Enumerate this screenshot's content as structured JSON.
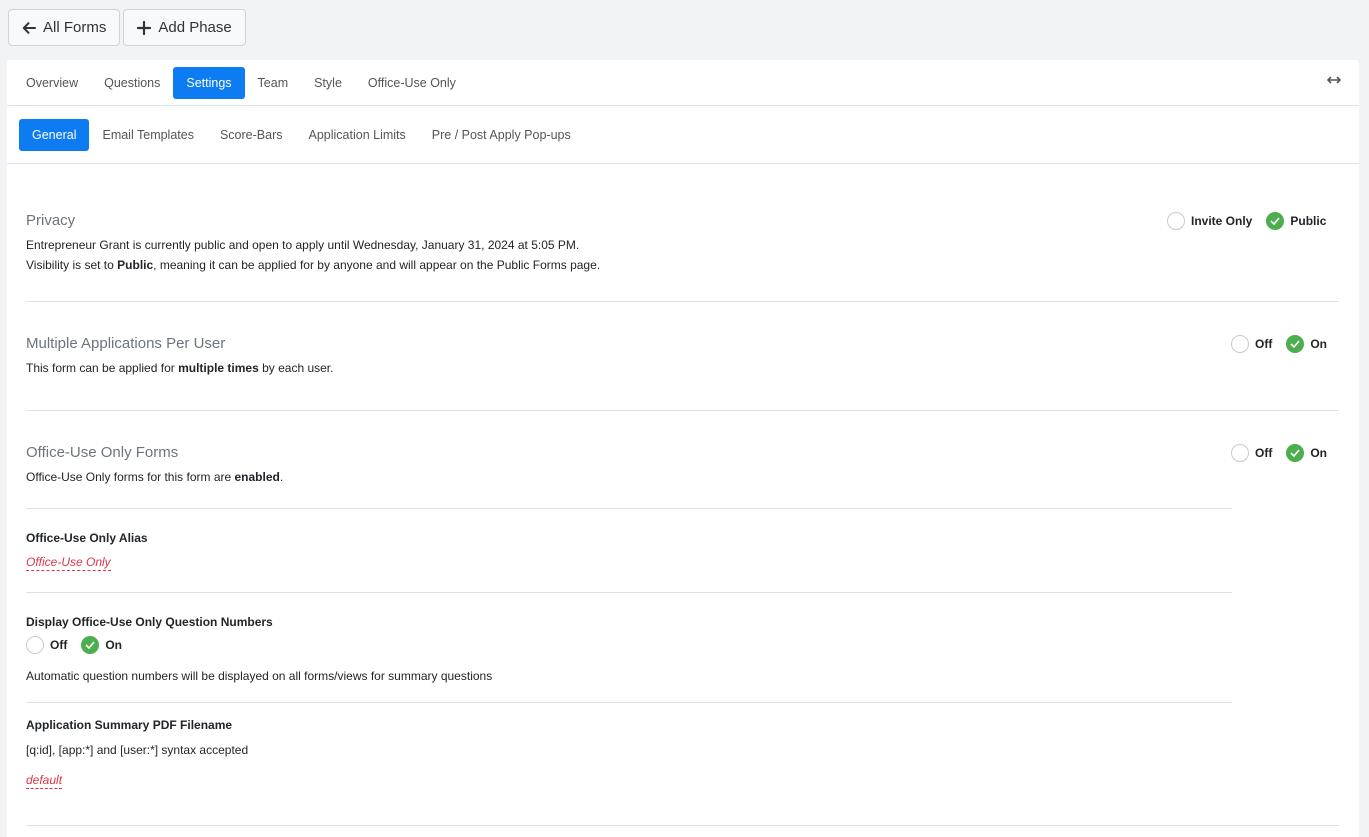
{
  "topbar": {
    "all_forms": "All Forms",
    "add_phase": "Add Phase"
  },
  "main_tabs": [
    "Overview",
    "Questions",
    "Settings",
    "Team",
    "Style",
    "Office-Use Only"
  ],
  "sub_tabs": [
    "General",
    "Email Templates",
    "Score-Bars",
    "Application Limits",
    "Pre / Post Apply Pop-ups"
  ],
  "privacy": {
    "title": "Privacy",
    "line1": "Entrepreneur Grant is currently public and open to apply until Wednesday, January 31, 2024 at 5:05 PM.",
    "line2_pre": "Visibility is set to ",
    "line2_bold": "Public",
    "line2_post": ", meaning it can be applied for by anyone and will appear on the Public Forms page.",
    "opt_invite": "Invite Only",
    "opt_public": "Public"
  },
  "multiple": {
    "title": "Multiple Applications Per User",
    "pre": "This form can be applied for ",
    "bold": "multiple times",
    "post": " by each user.",
    "off": "Off",
    "on": "On"
  },
  "office": {
    "title": "Office-Use Only Forms",
    "pre": "Office-Use Only forms for this form are ",
    "bold": "enabled",
    "post": ".",
    "off": "Off",
    "on": "On"
  },
  "alias": {
    "label": "Office-Use Only Alias",
    "value": "Office-Use Only"
  },
  "qnumbers": {
    "label": "Display Office-Use Only Question Numbers",
    "off": "Off",
    "on": "On",
    "desc": "Automatic question numbers will be displayed on all forms/views for summary questions"
  },
  "pdf": {
    "label": "Application Summary PDF Filename",
    "desc": "[q:id], [app:*] and [user:*] syntax accepted",
    "value": "default"
  },
  "colors": {
    "accent": "#0d7cf2",
    "on_green": "#4cae4f",
    "link_red": "#dc3545"
  }
}
